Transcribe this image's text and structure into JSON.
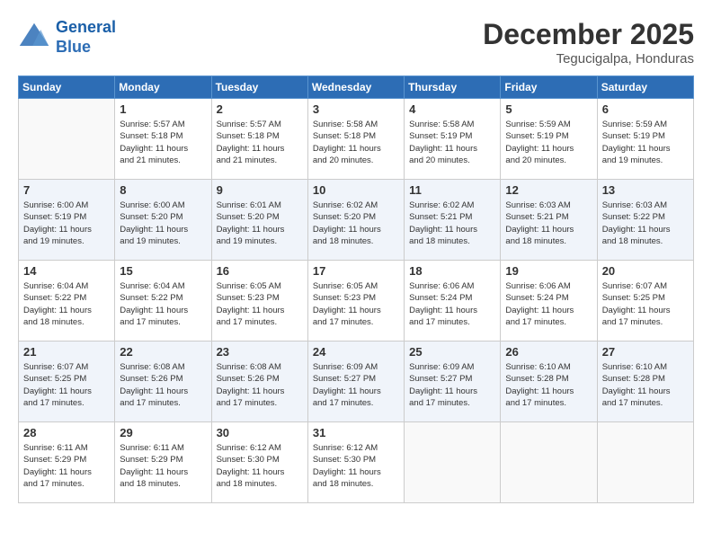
{
  "header": {
    "logo_line1": "General",
    "logo_line2": "Blue",
    "month": "December 2025",
    "location": "Tegucigalpa, Honduras"
  },
  "weekdays": [
    "Sunday",
    "Monday",
    "Tuesday",
    "Wednesday",
    "Thursday",
    "Friday",
    "Saturday"
  ],
  "weeks": [
    [
      {
        "day": "",
        "info": ""
      },
      {
        "day": "1",
        "info": "Sunrise: 5:57 AM\nSunset: 5:18 PM\nDaylight: 11 hours\nand 21 minutes."
      },
      {
        "day": "2",
        "info": "Sunrise: 5:57 AM\nSunset: 5:18 PM\nDaylight: 11 hours\nand 21 minutes."
      },
      {
        "day": "3",
        "info": "Sunrise: 5:58 AM\nSunset: 5:18 PM\nDaylight: 11 hours\nand 20 minutes."
      },
      {
        "day": "4",
        "info": "Sunrise: 5:58 AM\nSunset: 5:19 PM\nDaylight: 11 hours\nand 20 minutes."
      },
      {
        "day": "5",
        "info": "Sunrise: 5:59 AM\nSunset: 5:19 PM\nDaylight: 11 hours\nand 20 minutes."
      },
      {
        "day": "6",
        "info": "Sunrise: 5:59 AM\nSunset: 5:19 PM\nDaylight: 11 hours\nand 19 minutes."
      }
    ],
    [
      {
        "day": "7",
        "info": "Sunrise: 6:00 AM\nSunset: 5:19 PM\nDaylight: 11 hours\nand 19 minutes."
      },
      {
        "day": "8",
        "info": "Sunrise: 6:00 AM\nSunset: 5:20 PM\nDaylight: 11 hours\nand 19 minutes."
      },
      {
        "day": "9",
        "info": "Sunrise: 6:01 AM\nSunset: 5:20 PM\nDaylight: 11 hours\nand 19 minutes."
      },
      {
        "day": "10",
        "info": "Sunrise: 6:02 AM\nSunset: 5:20 PM\nDaylight: 11 hours\nand 18 minutes."
      },
      {
        "day": "11",
        "info": "Sunrise: 6:02 AM\nSunset: 5:21 PM\nDaylight: 11 hours\nand 18 minutes."
      },
      {
        "day": "12",
        "info": "Sunrise: 6:03 AM\nSunset: 5:21 PM\nDaylight: 11 hours\nand 18 minutes."
      },
      {
        "day": "13",
        "info": "Sunrise: 6:03 AM\nSunset: 5:22 PM\nDaylight: 11 hours\nand 18 minutes."
      }
    ],
    [
      {
        "day": "14",
        "info": "Sunrise: 6:04 AM\nSunset: 5:22 PM\nDaylight: 11 hours\nand 18 minutes."
      },
      {
        "day": "15",
        "info": "Sunrise: 6:04 AM\nSunset: 5:22 PM\nDaylight: 11 hours\nand 17 minutes."
      },
      {
        "day": "16",
        "info": "Sunrise: 6:05 AM\nSunset: 5:23 PM\nDaylight: 11 hours\nand 17 minutes."
      },
      {
        "day": "17",
        "info": "Sunrise: 6:05 AM\nSunset: 5:23 PM\nDaylight: 11 hours\nand 17 minutes."
      },
      {
        "day": "18",
        "info": "Sunrise: 6:06 AM\nSunset: 5:24 PM\nDaylight: 11 hours\nand 17 minutes."
      },
      {
        "day": "19",
        "info": "Sunrise: 6:06 AM\nSunset: 5:24 PM\nDaylight: 11 hours\nand 17 minutes."
      },
      {
        "day": "20",
        "info": "Sunrise: 6:07 AM\nSunset: 5:25 PM\nDaylight: 11 hours\nand 17 minutes."
      }
    ],
    [
      {
        "day": "21",
        "info": "Sunrise: 6:07 AM\nSunset: 5:25 PM\nDaylight: 11 hours\nand 17 minutes."
      },
      {
        "day": "22",
        "info": "Sunrise: 6:08 AM\nSunset: 5:26 PM\nDaylight: 11 hours\nand 17 minutes."
      },
      {
        "day": "23",
        "info": "Sunrise: 6:08 AM\nSunset: 5:26 PM\nDaylight: 11 hours\nand 17 minutes."
      },
      {
        "day": "24",
        "info": "Sunrise: 6:09 AM\nSunset: 5:27 PM\nDaylight: 11 hours\nand 17 minutes."
      },
      {
        "day": "25",
        "info": "Sunrise: 6:09 AM\nSunset: 5:27 PM\nDaylight: 11 hours\nand 17 minutes."
      },
      {
        "day": "26",
        "info": "Sunrise: 6:10 AM\nSunset: 5:28 PM\nDaylight: 11 hours\nand 17 minutes."
      },
      {
        "day": "27",
        "info": "Sunrise: 6:10 AM\nSunset: 5:28 PM\nDaylight: 11 hours\nand 17 minutes."
      }
    ],
    [
      {
        "day": "28",
        "info": "Sunrise: 6:11 AM\nSunset: 5:29 PM\nDaylight: 11 hours\nand 17 minutes."
      },
      {
        "day": "29",
        "info": "Sunrise: 6:11 AM\nSunset: 5:29 PM\nDaylight: 11 hours\nand 18 minutes."
      },
      {
        "day": "30",
        "info": "Sunrise: 6:12 AM\nSunset: 5:30 PM\nDaylight: 11 hours\nand 18 minutes."
      },
      {
        "day": "31",
        "info": "Sunrise: 6:12 AM\nSunset: 5:30 PM\nDaylight: 11 hours\nand 18 minutes."
      },
      {
        "day": "",
        "info": ""
      },
      {
        "day": "",
        "info": ""
      },
      {
        "day": "",
        "info": ""
      }
    ]
  ]
}
